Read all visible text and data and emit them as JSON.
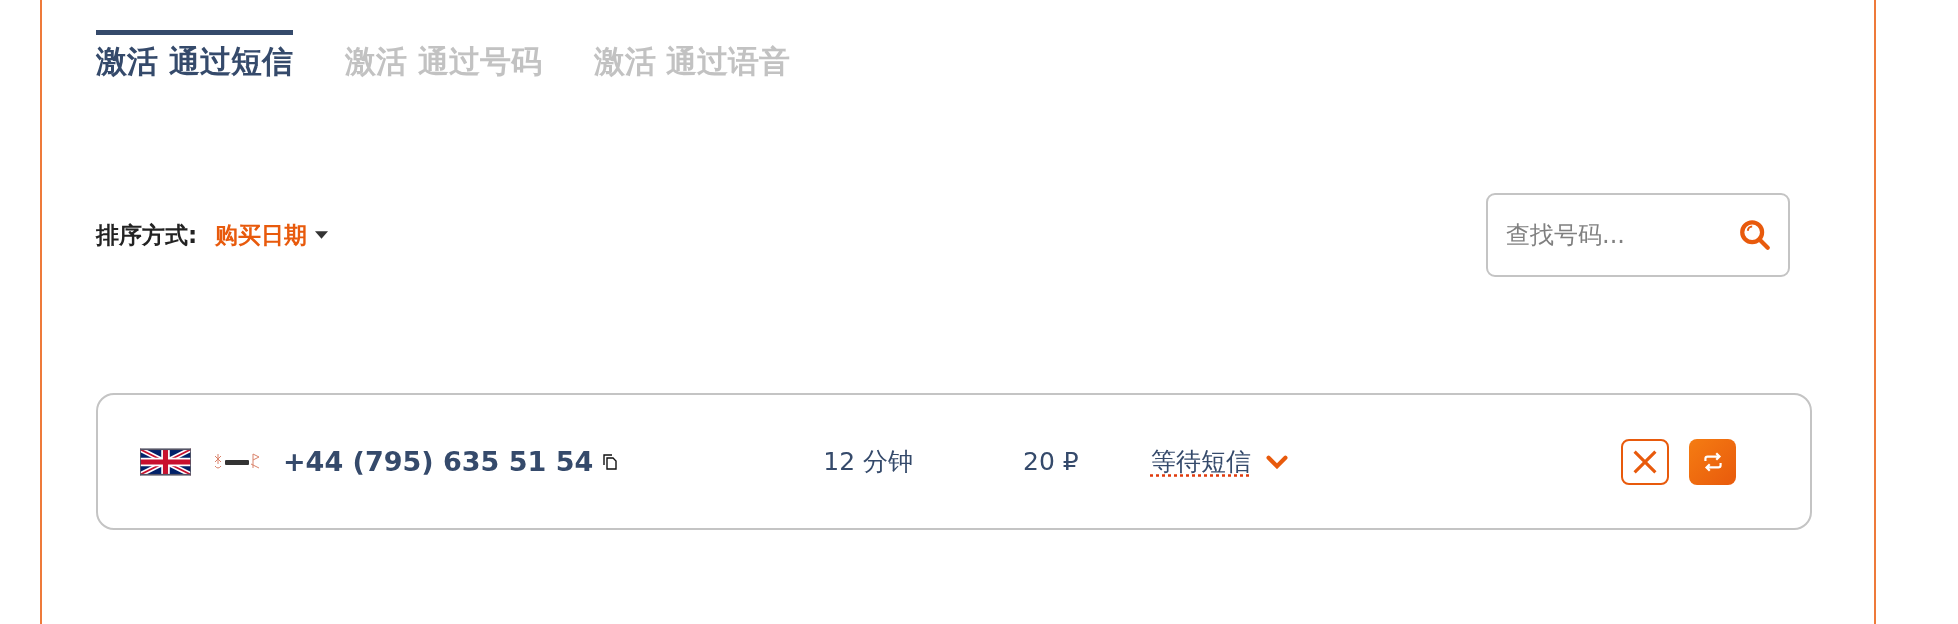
{
  "tabs": [
    {
      "label": "激活 通过短信",
      "selected": true
    },
    {
      "label": "激活 通过号码",
      "selected": false
    },
    {
      "label": "激活 通过语音",
      "selected": false
    }
  ],
  "sort": {
    "label": "排序方式:",
    "value": "购买日期"
  },
  "search": {
    "placeholder": "查找号码..."
  },
  "rows": [
    {
      "phone": "+44 (795) 635 51 54",
      "time": "12 分钟",
      "price": "20 ₽",
      "status": "等待短信"
    }
  ]
}
